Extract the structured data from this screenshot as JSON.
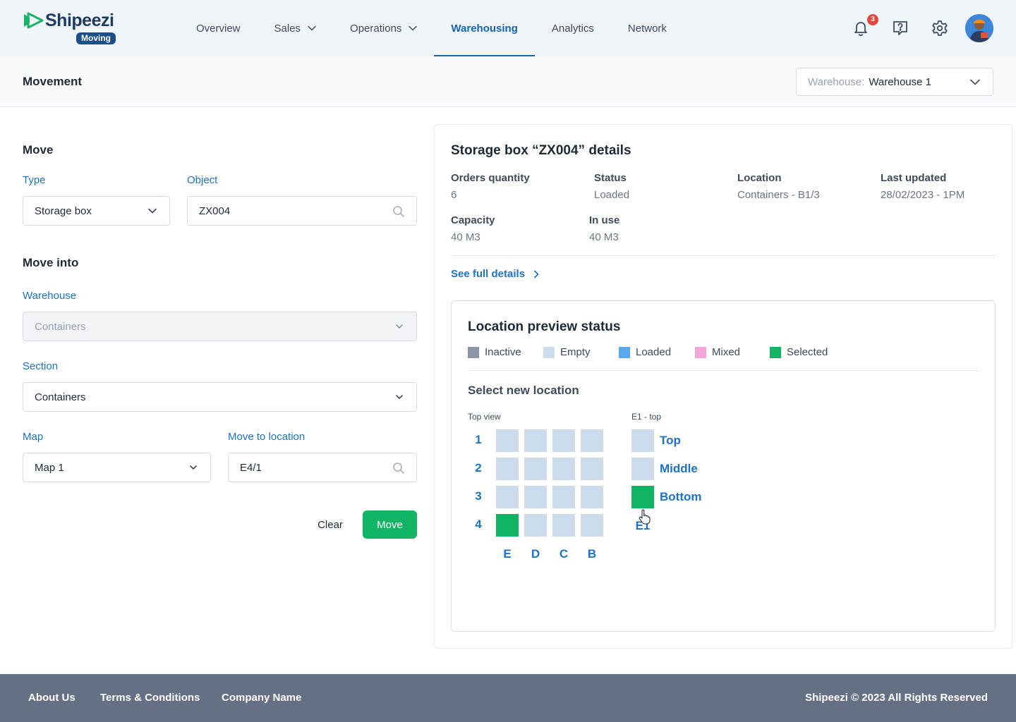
{
  "brand": {
    "name": "Shipeezi",
    "badge": "Moving"
  },
  "nav": {
    "items": [
      {
        "label": "Overview",
        "has_dropdown": false,
        "active": false
      },
      {
        "label": "Sales",
        "has_dropdown": true,
        "active": false
      },
      {
        "label": "Operations",
        "has_dropdown": true,
        "active": false
      },
      {
        "label": "Warehousing",
        "has_dropdown": false,
        "active": true
      },
      {
        "label": "Analytics",
        "has_dropdown": false,
        "active": false
      },
      {
        "label": "Network",
        "has_dropdown": false,
        "active": false
      }
    ],
    "notification_count": "3"
  },
  "header": {
    "title": "Movement",
    "warehouse_label": "Warehouse:",
    "warehouse_value": "Warehouse 1"
  },
  "form": {
    "move_heading": "Move",
    "type_label": "Type",
    "type_value": "Storage box",
    "object_label": "Object",
    "object_value": "ZX004",
    "move_into_heading": "Move into",
    "warehouse_label": "Warehouse",
    "warehouse_value": "Containers",
    "section_label": "Section",
    "section_value": "Containers",
    "map_label": "Map",
    "map_value": "Map 1",
    "location_label": "Move to location",
    "location_value": "E4/1",
    "clear_label": "Clear",
    "move_label": "Move"
  },
  "details": {
    "title": "Storage box “ZX004” details",
    "orders_quantity_label": "Orders quantity",
    "orders_quantity_value": "6",
    "status_label": "Status",
    "status_value": "Loaded",
    "location_label": "Location",
    "location_value": "Containers - B1/3",
    "last_updated_label": "Last updated",
    "last_updated_value": "28/02/2023 - 1PM",
    "capacity_label": "Capacity",
    "capacity_value": "40 M3",
    "in_use_label": "In use",
    "in_use_value": "40 M3",
    "see_full_label": "See full details"
  },
  "preview": {
    "title": "Location preview status",
    "legend": [
      {
        "label": "Inactive",
        "color": "#8a96a8"
      },
      {
        "label": "Empty",
        "color": "#cddced"
      },
      {
        "label": "Loaded",
        "color": "#5aa9ef"
      },
      {
        "label": "Mixed",
        "color": "#f4a6dc"
      },
      {
        "label": "Selected",
        "color": "#12b563"
      }
    ],
    "select_label": "Select new location",
    "top_view_label": "Top view",
    "rows": [
      "1",
      "2",
      "3",
      "4"
    ],
    "columns": [
      "E",
      "D",
      "C",
      "B"
    ],
    "selected_cell": "E4",
    "level_view_label": "E1 - top",
    "levels": [
      {
        "label": "Top",
        "selected": false
      },
      {
        "label": "Middle",
        "selected": false
      },
      {
        "label": "Bottom",
        "selected": true
      }
    ],
    "level_column_label": "E1"
  },
  "footer": {
    "about": "About Us",
    "terms": "Terms & Conditions",
    "company": "Company Name",
    "copyright": "Shipeezi © 2023 All Rights Reserved"
  }
}
